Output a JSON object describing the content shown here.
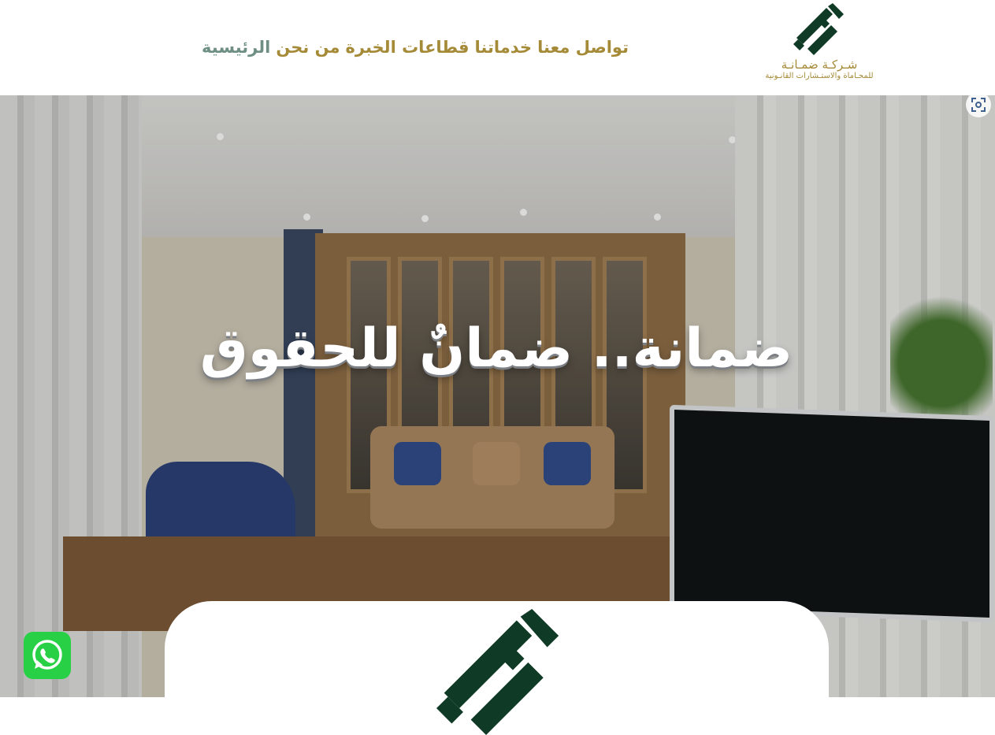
{
  "header": {
    "logo": {
      "icon": "dhamana-logo-icon",
      "name": "شـركـة ضمـانـة",
      "tagline": "للمحـاماة والاستـشارات القانـونية"
    },
    "nav": [
      {
        "label": "الرئيسية",
        "active": true
      },
      {
        "label": "من نحن",
        "active": false
      },
      {
        "label": "قطاعات الخبرة",
        "active": false
      },
      {
        "label": "خدماتنا",
        "active": false
      },
      {
        "label": "تواصل معنا",
        "active": false
      }
    ]
  },
  "hero": {
    "title": "ضمانة.. ضمانٌ للحقوق",
    "zoom_icon": "focus-scan-icon"
  },
  "card": {
    "logo_icon": "dhamana-logo-icon"
  },
  "whatsapp": {
    "icon": "whatsapp-icon"
  },
  "colors": {
    "gold": "#a58a38",
    "active_nav": "#6f8f84",
    "logo_green": "#0f3a26",
    "whatsapp": "#27d045"
  }
}
